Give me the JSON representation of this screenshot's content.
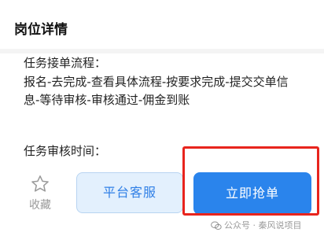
{
  "header": {
    "title": "岗位详情"
  },
  "task": {
    "flow_label": "任务接单流程：",
    "flow_steps": "报名-去完成-查看具体流程-按要求完成-提交交单信\n息-等待审核-审核通过-佣金到账",
    "review_time_label": "任务审核时间："
  },
  "actions": {
    "favorite_label": "收藏",
    "favorite_icon": "star-outline-icon",
    "service_label": "平台客服",
    "grab_label": "立即抢单"
  },
  "overlay": {
    "highlight_color": "#e8241d",
    "watermark_text": "公众号 · 秦风说项目",
    "watermark_icon": "wechat-icon"
  },
  "colors": {
    "primary": "#2a84ec",
    "secondary_bg": "#e3f0fd",
    "secondary_text": "#2f7fe6"
  }
}
